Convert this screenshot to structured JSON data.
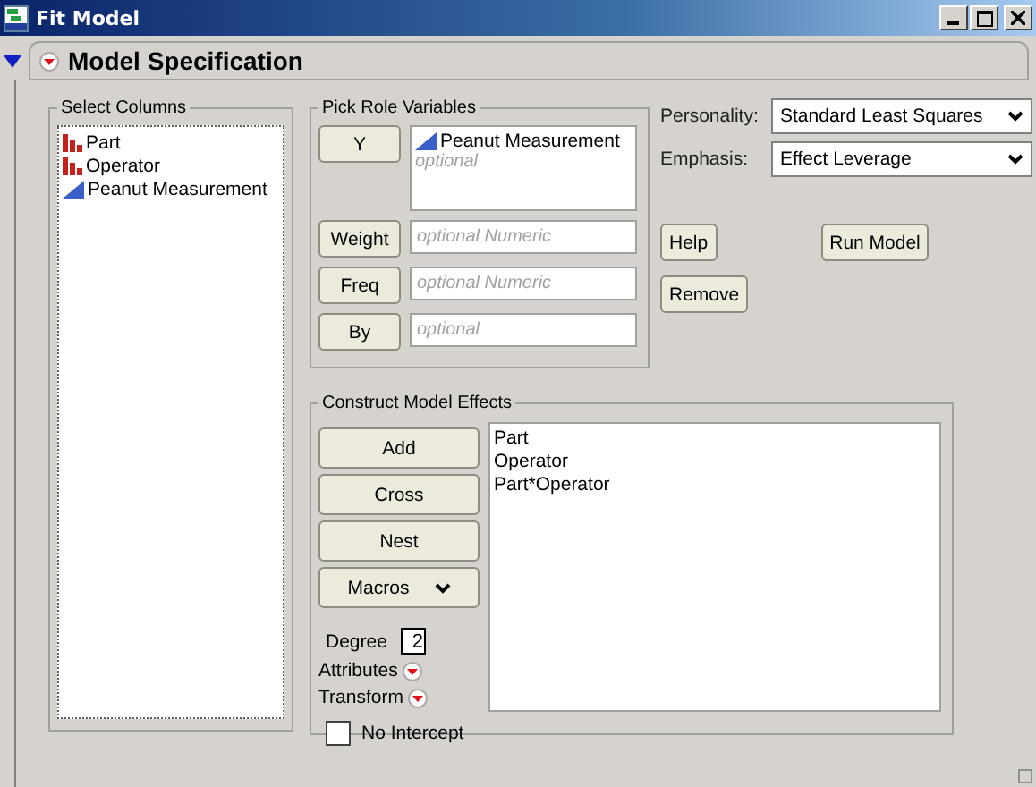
{
  "window": {
    "title": "Fit Model"
  },
  "outline": {
    "title": "Model Specification",
    "expanded": true
  },
  "select_columns": {
    "title": "Select Columns",
    "columns": [
      {
        "name": "Part",
        "kind": "nominal",
        "selected": false
      },
      {
        "name": "Operator",
        "kind": "nominal",
        "selected": false
      },
      {
        "name": "Peanut Measurement",
        "kind": "continuous",
        "selected": false
      }
    ]
  },
  "pick_roles": {
    "title": "Pick Role Variables",
    "roles": [
      {
        "label": "Y",
        "items": [
          {
            "name": "Peanut Measurement",
            "kind": "continuous"
          }
        ],
        "placeholder": "optional"
      },
      {
        "label": "Weight",
        "placeholder": "optional Numeric"
      },
      {
        "label": "Freq",
        "placeholder": "optional Numeric"
      },
      {
        "label": "By",
        "placeholder": "optional"
      }
    ]
  },
  "personality": {
    "label": "Personality:",
    "value": "Standard Least Squares"
  },
  "emphasis": {
    "label": "Emphasis:",
    "value": "Effect Leverage"
  },
  "buttons": {
    "help": "Help",
    "run": "Run Model",
    "remove": "Remove"
  },
  "effects": {
    "title": "Construct Model Effects",
    "buttons": [
      "Add",
      "Cross",
      "Nest"
    ],
    "macros": "Macros",
    "degree": {
      "label": "Degree",
      "value": "2"
    },
    "popups": [
      "Attributes",
      "Transform"
    ],
    "no_intercept": {
      "label": "No Intercept",
      "checked": false
    },
    "items": [
      {
        "name": "Part",
        "selected": false
      },
      {
        "name": "Operator",
        "selected": false
      },
      {
        "name": "Part*Operator",
        "selected": false
      }
    ]
  }
}
